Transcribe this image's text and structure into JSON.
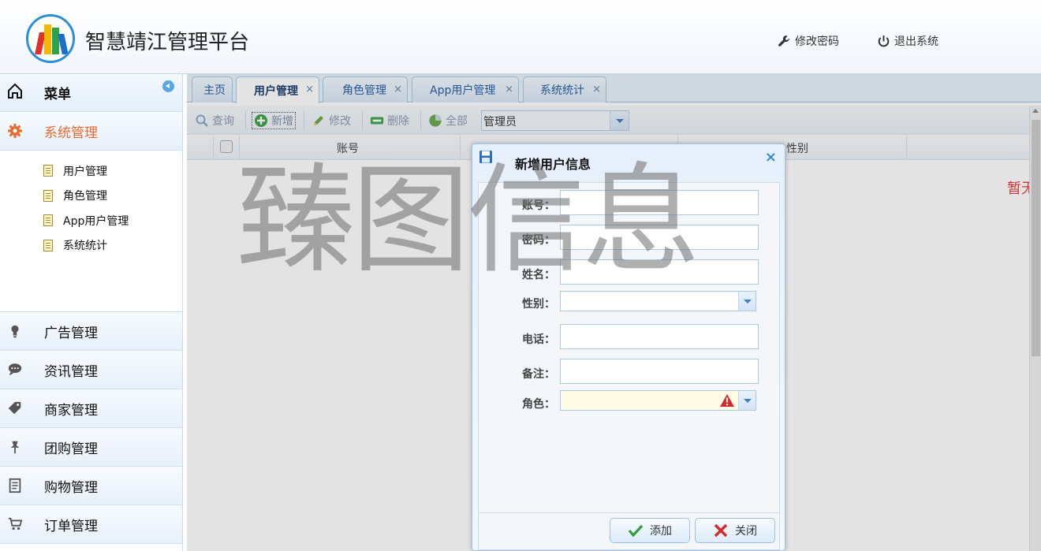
{
  "header": {
    "title": "智慧靖江管理平台",
    "change_password": "修改密码",
    "logout": "退出系统"
  },
  "sidebar": {
    "menu_title": "菜单",
    "active_group": "系统管理",
    "sub_items": [
      "用户管理",
      "角色管理",
      "App用户管理",
      "系统统计"
    ],
    "groups": [
      "广告管理",
      "资讯管理",
      "商家管理",
      "团购管理",
      "购物管理",
      "订单管理"
    ]
  },
  "tabs": [
    {
      "label": "主页",
      "closable": false
    },
    {
      "label": "用户管理",
      "closable": true,
      "active": true
    },
    {
      "label": "角色管理",
      "closable": true
    },
    {
      "label": "App用户管理",
      "closable": true
    },
    {
      "label": "系统统计",
      "closable": true
    }
  ],
  "tab_close_glyph": "×",
  "toolbar": {
    "query": "查询",
    "add": "新增",
    "edit": "修改",
    "delete": "删除",
    "all": "全部",
    "role_filter": "管理员"
  },
  "grid": {
    "columns": [
      "账号",
      "性别"
    ],
    "empty_text": "暂无"
  },
  "dialog": {
    "title": "新增用户信息",
    "close_glyph": "×",
    "fields": [
      {
        "label": "账号：",
        "value": ""
      },
      {
        "label": "密码：",
        "value": ""
      },
      {
        "label": "姓名：",
        "value": ""
      },
      {
        "label": "性别：",
        "value": ""
      },
      {
        "label": "电话：",
        "value": ""
      },
      {
        "label": "备注：",
        "value": ""
      },
      {
        "label": "角色：",
        "value": ""
      }
    ],
    "add_button": "添加",
    "close_button": "关闭"
  },
  "watermark": "臻图信息",
  "colors": {
    "accent": "#2a8fd6",
    "active_menu": "#e86a2c",
    "empty_text": "#e83a3a"
  }
}
